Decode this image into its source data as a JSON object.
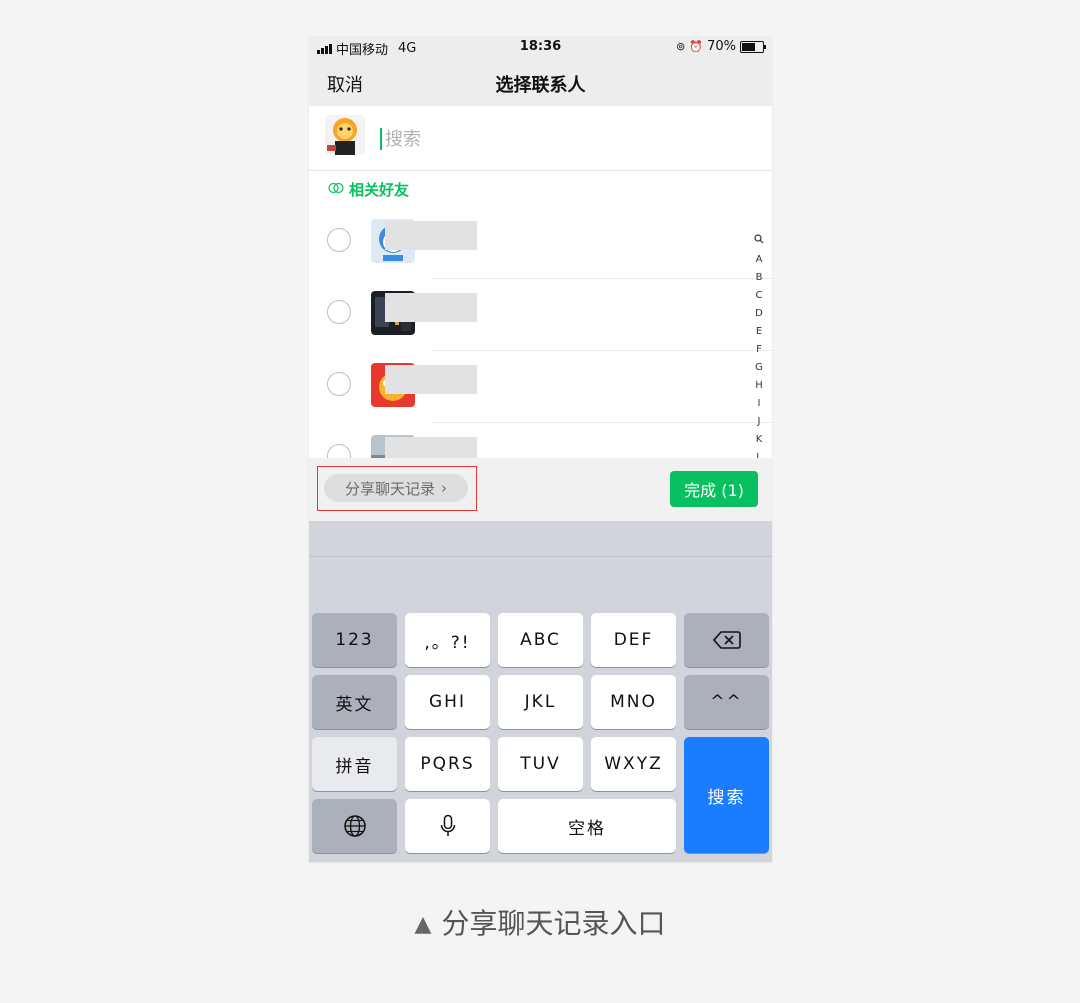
{
  "status_bar": {
    "carrier": "中国移动",
    "network": "4G",
    "time": "18:36",
    "battery": "70%",
    "battery_level": 0.7
  },
  "nav": {
    "cancel_label": "取消",
    "title": "选择联系人"
  },
  "search": {
    "placeholder": "搜索"
  },
  "section": {
    "label": "相关好友"
  },
  "contacts": [
    {
      "name": ""
    },
    {
      "name": ""
    },
    {
      "name": ""
    },
    {
      "name": ""
    }
  ],
  "index_letters": [
    "A",
    "B",
    "C",
    "D",
    "E",
    "F",
    "G",
    "H",
    "I",
    "J",
    "K",
    "L"
  ],
  "actions": {
    "share_label": "分享聊天记录",
    "share_chevron": "›",
    "done_label": "完成 (1)"
  },
  "keyboard": {
    "k123": "123",
    "punct": ",。?!",
    "abc": "ABC",
    "def": "DEF",
    "english": "英文",
    "ghi": "GHI",
    "jkl": "JKL",
    "mno": "MNO",
    "emoji": "^^",
    "pinyin": "拼音",
    "pqrs": "PQRS",
    "tuv": "TUV",
    "wxyz": "WXYZ",
    "space": "空格",
    "search": "搜索"
  },
  "caption": {
    "marker": "▲",
    "text": "分享聊天记录入口"
  },
  "colors": {
    "accent": "#07c160",
    "keyboard_blue": "#1a7cff",
    "highlight": "#e53935"
  }
}
